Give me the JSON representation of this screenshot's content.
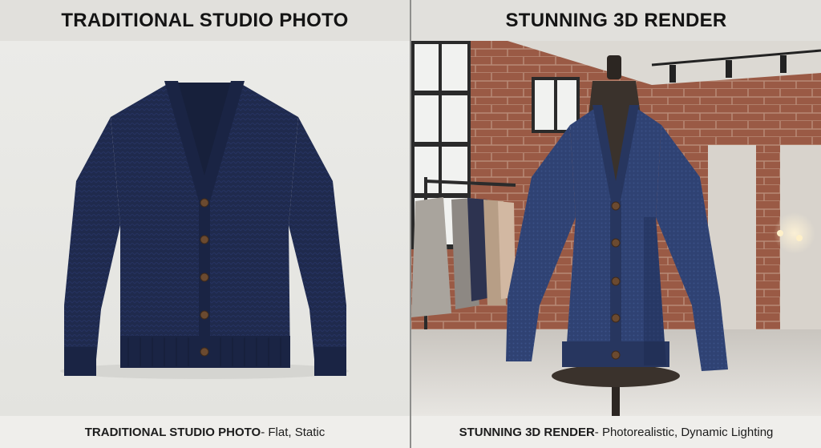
{
  "left_panel": {
    "header": "TRADITIONAL STUDIO PHOTO",
    "caption_title": "TRADITIONAL STUDIO PHOTO",
    "caption_detail": " - Flat, Static"
  },
  "right_panel": {
    "header": "STUNNING 3D RENDER",
    "caption_title": "STUNNING 3D RENDER",
    "caption_detail": " - Photorealistic, Dynamic Lighting"
  },
  "colors": {
    "cardigan_navy": "#1f2a4d",
    "cardigan_render": "#2f4273",
    "button_brown": "#6b4a30",
    "brick": "#9a5a45",
    "studio_background": "#e9e9e6"
  },
  "icons": {
    "left_image": "flat-cardigan-photo",
    "right_image": "cardigan-on-mannequin-render"
  }
}
